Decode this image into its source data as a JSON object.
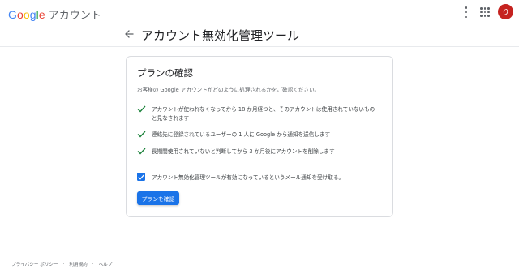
{
  "header": {
    "logo_letters": [
      "G",
      "o",
      "o",
      "g",
      "l",
      "e"
    ],
    "product_name": "アカウント",
    "avatar_letter": "り",
    "avatar_color": "#c5221f",
    "page_title": "アカウント無効化管理ツール"
  },
  "card": {
    "title": "プランの確認",
    "subtitle": "お客様の Google アカウントがどのように処理されるかをご確認ください。",
    "items": [
      {
        "text": "アカウントが使われなくなってから 18 か月経つと、そのアカウントは使用されていないものと見なされます"
      },
      {
        "text": "連絡先に登録されているユーザーの 1 人に Google から通知を送信します"
      },
      {
        "text": "長期間使用されていないと判断してから 3 か月後にアカウントを削除します"
      }
    ],
    "optin_label": "アカウント無効化管理ツールが有効になっているというメール通知を受け取る。",
    "optin_checked": true,
    "confirm_button": "プランを確認"
  },
  "footer": {
    "links": [
      "プライバシー ポリシー",
      "利用規約",
      "ヘルプ"
    ],
    "separator": "·"
  },
  "colors": {
    "accent": "#1a73e8",
    "check": "#188038",
    "text": "#202124",
    "muted": "#5f6368"
  }
}
